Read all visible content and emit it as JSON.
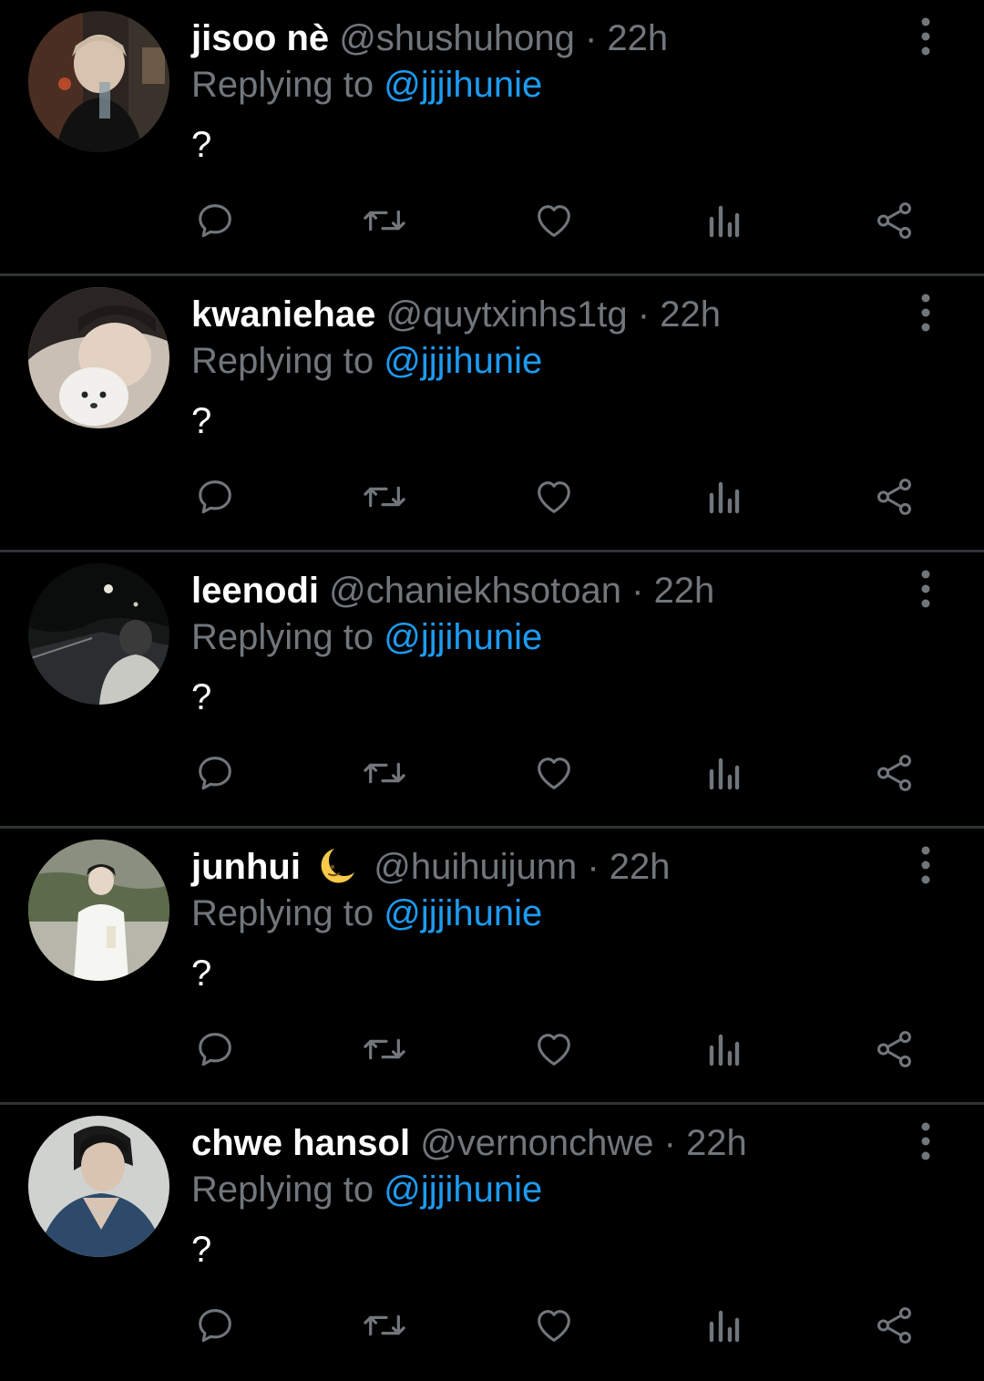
{
  "theme": {
    "background": "#000000",
    "divider": "#2f3336",
    "muted": "#71767b",
    "accent": "#1d9bf0",
    "text": "#ffffff"
  },
  "icons": {
    "reply": "reply-icon",
    "retweet": "retweet-icon",
    "like": "heart-icon",
    "views": "views-icon",
    "share": "share-icon",
    "more": "more-vertical-icon"
  },
  "tweets": [
    {
      "display_name": "jisoo nè",
      "handle": "@shushuhong",
      "separator": "·",
      "time": "22h",
      "reply_prefix": "Replying to",
      "reply_to": "@jjjihunie",
      "text": "?"
    },
    {
      "display_name": "kwaniehae",
      "handle": "@quytxinhs1tg",
      "separator": "·",
      "time": "22h",
      "reply_prefix": "Replying to",
      "reply_to": "@jjjihunie",
      "text": "?"
    },
    {
      "display_name": "leenodi",
      "handle": "@chaniekhsotoan",
      "separator": "·",
      "time": "22h",
      "reply_prefix": "Replying to",
      "reply_to": "@jjjihunie",
      "text": "?"
    },
    {
      "display_name": "junhui",
      "name_emoji": "crescent-moon-face",
      "handle": "@huihuijunn",
      "separator": "·",
      "time": "22h",
      "reply_prefix": "Replying to",
      "reply_to": "@jjjihunie",
      "text": "?"
    },
    {
      "display_name": "chwe hansol",
      "handle": "@vernonchwe",
      "separator": "·",
      "time": "22h",
      "reply_prefix": "Replying to",
      "reply_to": "@jjjihunie",
      "text": "?"
    }
  ]
}
